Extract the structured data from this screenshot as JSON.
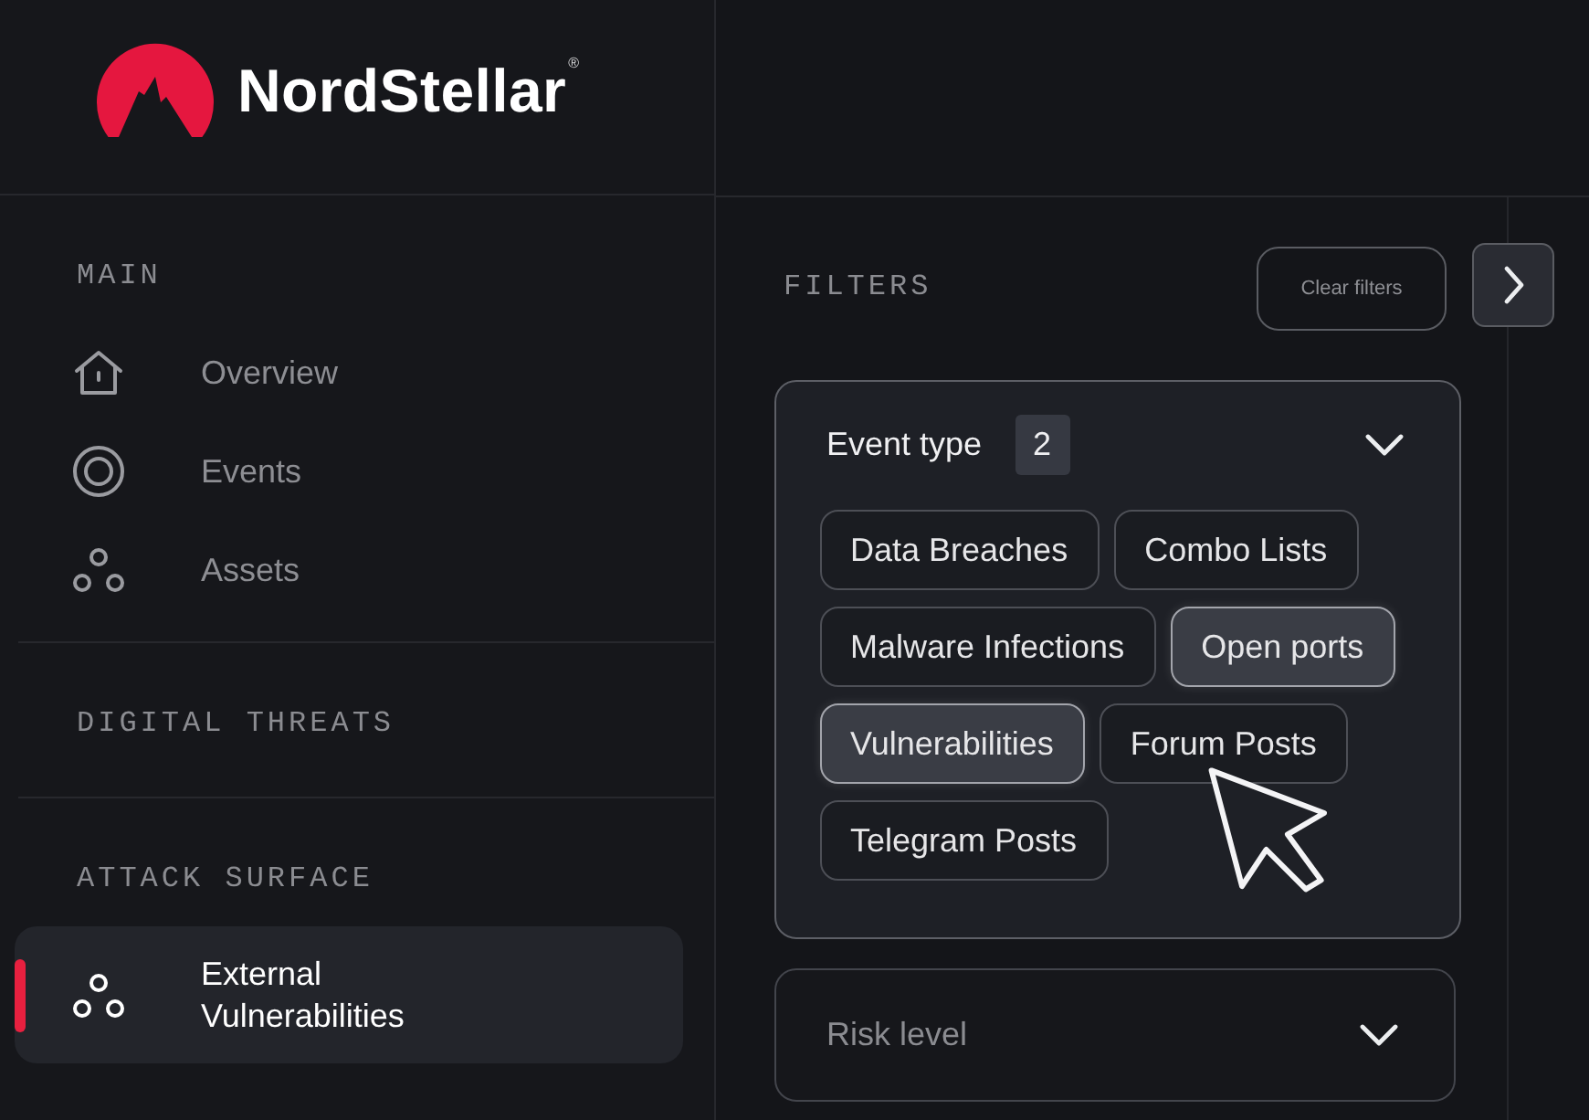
{
  "brand": {
    "name": "NordStellar",
    "mark": "®"
  },
  "sidebar": {
    "sections": [
      {
        "title": "MAIN",
        "items": [
          {
            "label": "Overview",
            "selected": false
          },
          {
            "label": "Events",
            "selected": false
          },
          {
            "label": "Assets",
            "selected": false
          }
        ]
      },
      {
        "title": "DIGITAL THREATS"
      },
      {
        "title": "ATTACK SURFACE",
        "items": [
          {
            "label": "External Vulnerabilities",
            "selected": true
          }
        ]
      }
    ]
  },
  "filters": {
    "title": "FILTERS",
    "clear_button": "Clear filters",
    "groups": [
      {
        "label": "Event type",
        "count": "2",
        "expanded": true,
        "options": [
          {
            "label": "Data Breaches",
            "selected": false
          },
          {
            "label": "Combo Lists",
            "selected": false
          },
          {
            "label": "Malware Infections",
            "selected": false
          },
          {
            "label": "Open ports",
            "selected": true
          },
          {
            "label": "Vulnerabilities",
            "selected": true
          },
          {
            "label": "Forum Posts",
            "selected": false
          },
          {
            "label": "Telegram Posts",
            "selected": false
          }
        ]
      },
      {
        "label": "Risk level",
        "expanded": false
      }
    ]
  }
}
